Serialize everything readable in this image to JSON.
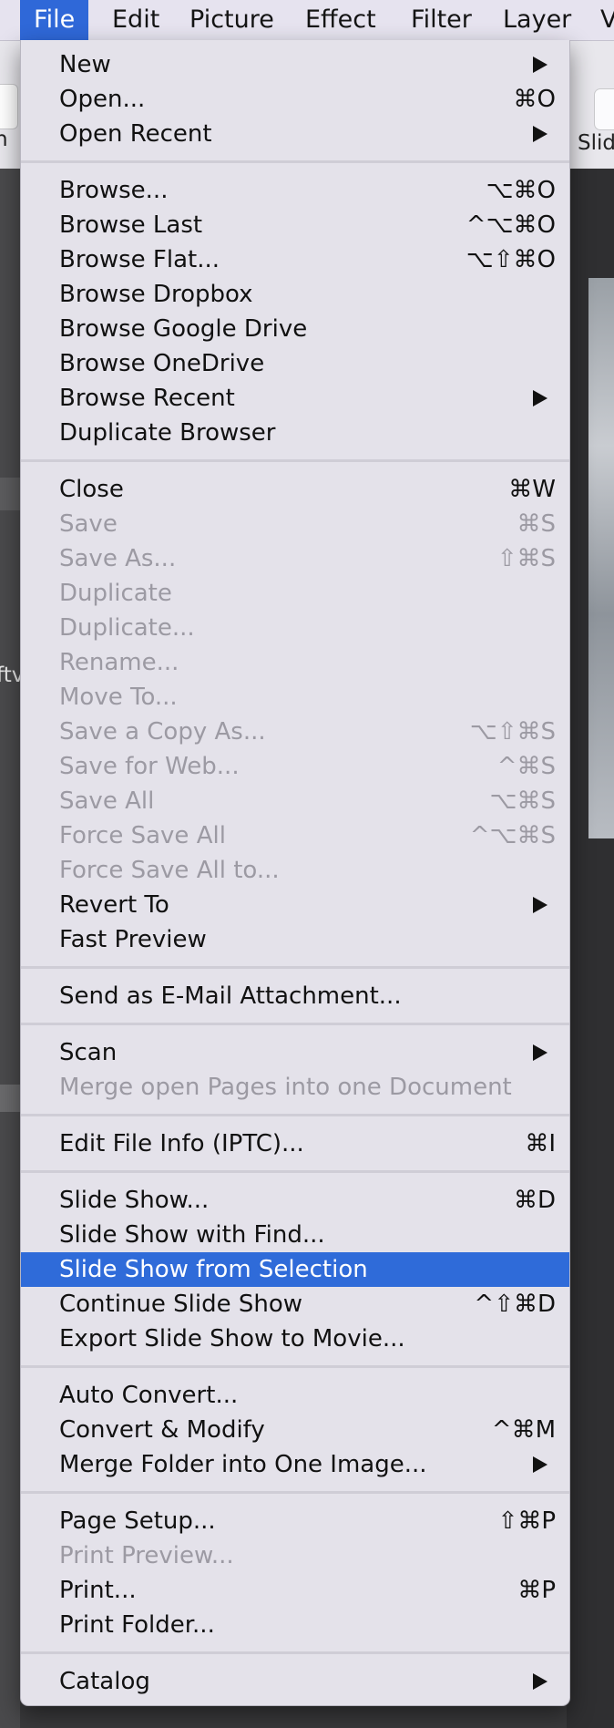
{
  "menubar": {
    "items": [
      {
        "label": "File",
        "active": true
      },
      {
        "label": "Edit"
      },
      {
        "label": "Picture"
      },
      {
        "label": "Effect"
      },
      {
        "label": "Filter"
      },
      {
        "label": "Layer"
      },
      {
        "label": "V"
      }
    ]
  },
  "background": {
    "left_toolbar_text": "n",
    "left_sidebar_text": "ftv",
    "right_toolbar_text": "Slid"
  },
  "file_menu": {
    "items": [
      {
        "label": "New",
        "shortcut": "",
        "submenu": true
      },
      {
        "label": "Open...",
        "shortcut": "⌘O"
      },
      {
        "label": "Open Recent",
        "shortcut": "",
        "submenu": true
      },
      {
        "label": "Browse...",
        "shortcut": "⌥⌘O"
      },
      {
        "label": "Browse Last",
        "shortcut": "^⌥⌘O"
      },
      {
        "label": "Browse Flat...",
        "shortcut": "⌥⇧⌘O"
      },
      {
        "label": "Browse Dropbox",
        "shortcut": ""
      },
      {
        "label": "Browse Google Drive",
        "shortcut": ""
      },
      {
        "label": "Browse OneDrive",
        "shortcut": ""
      },
      {
        "label": "Browse Recent",
        "shortcut": "",
        "submenu": true
      },
      {
        "label": "Duplicate Browser",
        "shortcut": ""
      },
      {
        "label": "Close",
        "shortcut": "⌘W"
      },
      {
        "label": "Save",
        "shortcut": "⌘S",
        "disabled": true
      },
      {
        "label": "Save As...",
        "shortcut": "⇧⌘S",
        "disabled": true
      },
      {
        "label": "Duplicate",
        "shortcut": "",
        "disabled": true
      },
      {
        "label": "Duplicate...",
        "shortcut": "",
        "disabled": true
      },
      {
        "label": "Rename...",
        "shortcut": "",
        "disabled": true
      },
      {
        "label": "Move To...",
        "shortcut": "",
        "disabled": true
      },
      {
        "label": "Save a Copy As...",
        "shortcut": "⌥⇧⌘S",
        "disabled": true
      },
      {
        "label": "Save for Web...",
        "shortcut": "^⌘S",
        "disabled": true
      },
      {
        "label": "Save All",
        "shortcut": "⌥⌘S",
        "disabled": true
      },
      {
        "label": "Force Save All",
        "shortcut": "^⌥⌘S",
        "disabled": true
      },
      {
        "label": "Force Save All to...",
        "shortcut": "",
        "disabled": true
      },
      {
        "label": "Revert To",
        "shortcut": "",
        "submenu": true
      },
      {
        "label": "Fast Preview",
        "shortcut": ""
      },
      {
        "label": "Send as E-Mail Attachment...",
        "shortcut": ""
      },
      {
        "label": "Scan",
        "shortcut": "",
        "submenu": true
      },
      {
        "label": "Merge open Pages into one Document",
        "shortcut": "",
        "disabled": true
      },
      {
        "label": "Edit File Info (IPTC)...",
        "shortcut": "⌘I"
      },
      {
        "label": "Slide Show...",
        "shortcut": "⌘D"
      },
      {
        "label": "Slide Show with Find...",
        "shortcut": ""
      },
      {
        "label": "Slide Show from Selection",
        "shortcut": "",
        "highlighted": true
      },
      {
        "label": "Continue Slide Show",
        "shortcut": "^⇧⌘D"
      },
      {
        "label": "Export Slide Show to Movie...",
        "shortcut": ""
      },
      {
        "label": "Auto Convert...",
        "shortcut": ""
      },
      {
        "label": "Convert & Modify",
        "shortcut": "^⌘M"
      },
      {
        "label": "Merge Folder into One Image...",
        "shortcut": "",
        "submenu": true
      },
      {
        "label": "Page Setup...",
        "shortcut": "⇧⌘P"
      },
      {
        "label": "Print Preview...",
        "shortcut": "",
        "disabled": true
      },
      {
        "label": "Print...",
        "shortcut": "⌘P"
      },
      {
        "label": "Print Folder...",
        "shortcut": ""
      },
      {
        "label": "Catalog",
        "shortcut": "",
        "submenu": true
      }
    ]
  }
}
